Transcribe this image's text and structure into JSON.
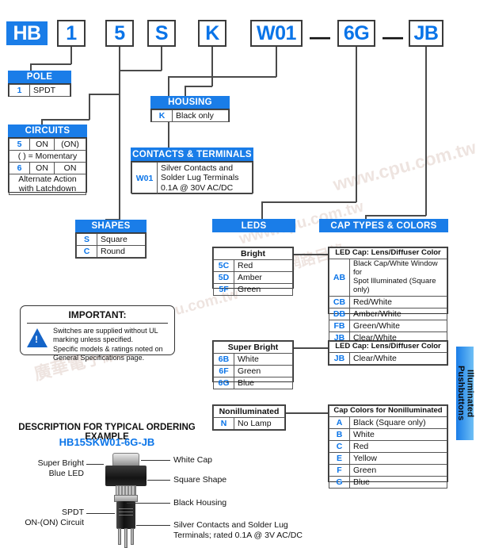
{
  "part_number_boxes": [
    {
      "code": "HB",
      "style": "filled"
    },
    {
      "code": "1",
      "style": "outline"
    },
    {
      "code": "5",
      "style": "outline"
    },
    {
      "code": "S",
      "style": "outline"
    },
    {
      "code": "K",
      "style": "outline"
    },
    {
      "code": "W01",
      "style": "outline"
    },
    {
      "code": "6G",
      "style": "outline"
    },
    {
      "code": "JB",
      "style": "outline"
    }
  ],
  "separators": [
    "—",
    "—"
  ],
  "headers": {
    "pole": "POLE",
    "circuits": "CIRCUITS",
    "housing": "HOUSING",
    "contacts": "CONTACTS & TERMINALS",
    "shapes": "SHAPES",
    "leds": "LEDS",
    "cap_types": "CAP TYPES & COLORS"
  },
  "pole_table": {
    "rows": [
      {
        "code": "1",
        "desc": "SPDT"
      }
    ]
  },
  "circuits_table": {
    "rows": [
      {
        "code": "5",
        "col2": "ON",
        "col3": "(ON)"
      },
      {
        "note": "(   ) = Momentary"
      },
      {
        "code": "6",
        "col2": "ON",
        "col3": "ON"
      },
      {
        "note": "Alternate Action\nwith Latchdown"
      }
    ],
    "note_momentary": "(   ) = Momentary",
    "note_alternate_line1": "Alternate Action",
    "note_alternate_line2": "with Latchdown"
  },
  "housing_table": {
    "rows": [
      {
        "code": "K",
        "desc": "Black only"
      }
    ]
  },
  "contacts_table": {
    "code": "W01",
    "desc_line1": "Silver Contacts and",
    "desc_line2": "Solder Lug Terminals",
    "desc_line3": "0.1A @ 30V AC/DC"
  },
  "shapes_table": {
    "rows": [
      {
        "code": "S",
        "desc": "Square"
      },
      {
        "code": "C",
        "desc": "Round"
      }
    ]
  },
  "bright_table": {
    "title": "Bright",
    "rows": [
      {
        "code": "5C",
        "desc": "Red"
      },
      {
        "code": "5D",
        "desc": "Amber"
      },
      {
        "code": "5F",
        "desc": "Green"
      }
    ]
  },
  "bright_caps_table": {
    "title": "LED Cap: Lens/Diffuser Color",
    "rows": [
      {
        "code": "AB",
        "desc": "Black Cap/White Window for\nSpot Illuminated (Square only)"
      },
      {
        "code": "CB",
        "desc": "Red/White"
      },
      {
        "code": "DB",
        "desc": "Amber/White"
      },
      {
        "code": "FB",
        "desc": "Green/White"
      },
      {
        "code": "JB",
        "desc": "Clear/White"
      }
    ],
    "ab_line1": "Black Cap/White Window for",
    "ab_line2": "Spot Illuminated (Square only)"
  },
  "superbright_table": {
    "title": "Super Bright",
    "rows": [
      {
        "code": "6B",
        "desc": "White"
      },
      {
        "code": "6F",
        "desc": "Green"
      },
      {
        "code": "6G",
        "desc": "Blue"
      }
    ]
  },
  "superbright_caps_table": {
    "title": "LED Cap: Lens/Diffuser Color",
    "rows": [
      {
        "code": "JB",
        "desc": "Clear/White"
      }
    ]
  },
  "nonilluminated_table": {
    "title": "Nonilluminated",
    "rows": [
      {
        "code": "N",
        "desc": "No Lamp"
      }
    ]
  },
  "nonilluminated_caps_table": {
    "title": "Cap Colors for Nonilluminated",
    "rows": [
      {
        "code": "A",
        "desc": "Black (Square only)"
      },
      {
        "code": "B",
        "desc": "White"
      },
      {
        "code": "C",
        "desc": "Red"
      },
      {
        "code": "E",
        "desc": "Yellow"
      },
      {
        "code": "F",
        "desc": "Green"
      },
      {
        "code": "G",
        "desc": "Blue"
      }
    ]
  },
  "important": {
    "title": "IMPORTANT:",
    "line1": "Switches are supplied without UL",
    "line2": "marking unless specified.",
    "line3": "Specific models & ratings noted on",
    "line4": "General Specifications page.",
    "icon": "warning-triangle"
  },
  "side_tab": {
    "line1": "Illuminated",
    "line2": "Pushbuttons"
  },
  "description": {
    "title": "DESCRIPTION FOR TYPICAL ORDERING EXAMPLE",
    "part_number": "HB15SKW01-6G-JB",
    "callouts_left": [
      {
        "line1": "Super Bright",
        "line2": "Blue LED"
      },
      {
        "line1": "SPDT",
        "line2": "ON-(ON) Circuit"
      }
    ],
    "callouts_right": [
      {
        "line1": "White Cap",
        "line2": ""
      },
      {
        "line1": "Square Shape",
        "line2": ""
      },
      {
        "line1": "Black Housing",
        "line2": ""
      },
      {
        "line1": "Silver Contacts and Solder Lug",
        "line2": "Terminals; rated 0.1A @ 3V AC/DC"
      }
    ]
  },
  "watermarks": [
    "www.cpu.com.tw",
    "廣華電子網路目錄"
  ],
  "colors": {
    "brand_blue": "#1a7de8",
    "code_blue": "#0a74e8",
    "line": "#4a4a4a",
    "text": "#111111"
  }
}
